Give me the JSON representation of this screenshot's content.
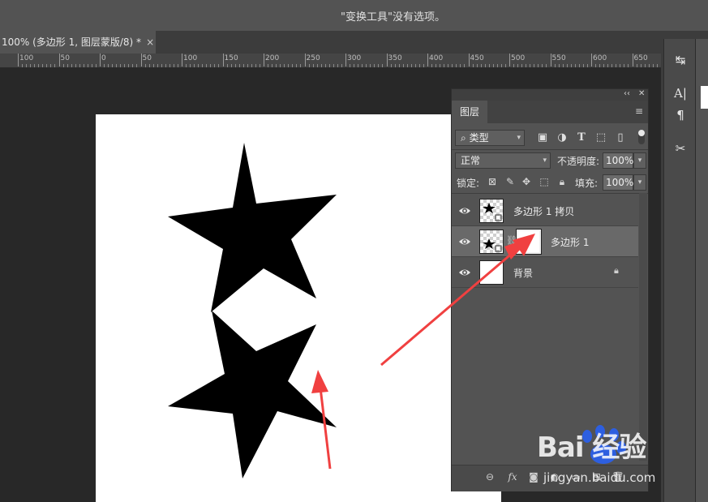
{
  "options_bar": {
    "message": "\"变换工具\"没有选项。"
  },
  "document_tab": {
    "title": "100% (多边形 1, 图层蒙版/8) *",
    "close_glyph": "×"
  },
  "ruler": {
    "labels": [
      "100",
      "50",
      "0",
      "50",
      "100",
      "150",
      "200",
      "250",
      "300",
      "350",
      "400",
      "450",
      "500",
      "550",
      "600",
      "650"
    ]
  },
  "layers_panel": {
    "collapse_glyph": "‹‹",
    "close_glyph": "✕",
    "tab_label": "图层",
    "filter": {
      "kind_label": "类型",
      "icons": [
        "image-filter-icon",
        "adjustment-filter-icon",
        "type-filter-icon",
        "shape-filter-icon",
        "smart-object-filter-icon"
      ]
    },
    "blend_mode": "正常",
    "opacity_label": "不透明度:",
    "opacity_value": "100%",
    "lock_label": "锁定:",
    "fill_label": "填充:",
    "fill_value": "100%",
    "layers": [
      {
        "name": "多边形 1 拷贝",
        "visible": true,
        "selected": false
      },
      {
        "name": "多边形 1",
        "visible": true,
        "selected": true,
        "has_mask": true
      },
      {
        "name": "背景",
        "visible": true,
        "selected": false,
        "locked": true
      }
    ],
    "bottom_icons": [
      "link-layers-icon",
      "fx-icon",
      "add-mask-icon",
      "adjustment-layer-icon",
      "group-icon",
      "new-layer-icon",
      "trash-icon"
    ]
  },
  "dock": {
    "icons": [
      "history-icon",
      "character-icon",
      "paragraph-icon",
      "tools-preset-icon"
    ]
  },
  "watermark": {
    "brand": "Bai 经验",
    "url": "jingyan.baidu.com"
  },
  "colors": {
    "arrow": "#f04040",
    "panel_bg": "#535353",
    "selected_row": "#696969",
    "canvas": "#ffffff"
  }
}
